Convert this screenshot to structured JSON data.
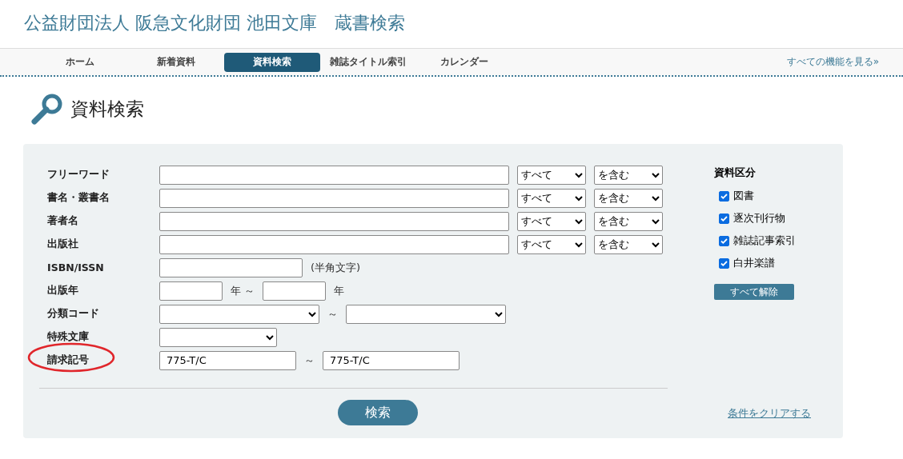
{
  "site_title": "公益財団法人 阪急文化財団 池田文庫　蔵書検索",
  "nav": {
    "items": [
      {
        "label": "ホーム",
        "selected": false
      },
      {
        "label": "新着資料",
        "selected": false
      },
      {
        "label": "資料検索",
        "selected": true
      },
      {
        "label": "雑誌タイトル索引",
        "selected": false
      },
      {
        "label": "カレンダー",
        "selected": false
      }
    ],
    "all_features": "すべての機能を見る»"
  },
  "page_title": "資料検索",
  "form": {
    "rows": [
      {
        "kind": "text",
        "label": "フリーワード",
        "value": "",
        "scope": "すべて",
        "match": "を含む",
        "circled": false
      },
      {
        "kind": "text",
        "label": "書名・叢書名",
        "value": "",
        "scope": "すべて",
        "match": "を含む",
        "circled": false
      },
      {
        "kind": "text",
        "label": "著者名",
        "value": "",
        "scope": "すべて",
        "match": "を含む",
        "circled": false
      },
      {
        "kind": "text",
        "label": "出版社",
        "value": "",
        "scope": "すべて",
        "match": "を含む",
        "circled": false
      },
      {
        "kind": "note",
        "label": "ISBN/ISSN",
        "value": "",
        "note": "(半角文字)",
        "circled": false
      },
      {
        "kind": "year",
        "label": "出版年",
        "from": "",
        "unit_from": "年 ～",
        "to": "",
        "unit_to": "年",
        "circled": false
      },
      {
        "kind": "select-range",
        "label": "分類コード",
        "from": "",
        "separator": "～",
        "to": "",
        "circled": false
      },
      {
        "kind": "select",
        "label": "特殊文庫",
        "value": "",
        "circled": false
      },
      {
        "kind": "text-range",
        "label": "請求記号",
        "from": "775-T/C",
        "separator": "～",
        "to": "775-T/C",
        "circled": true
      }
    ],
    "search_button": "検索",
    "clear_link": "条件をクリアする",
    "category": {
      "title": "資料区分",
      "items": [
        {
          "label": "図書",
          "checked": true
        },
        {
          "label": "逐次刊行物",
          "checked": true
        },
        {
          "label": "雑誌記事索引",
          "checked": true
        },
        {
          "label": "白井楽譜",
          "checked": true
        }
      ],
      "clear_all": "すべて解除"
    }
  }
}
